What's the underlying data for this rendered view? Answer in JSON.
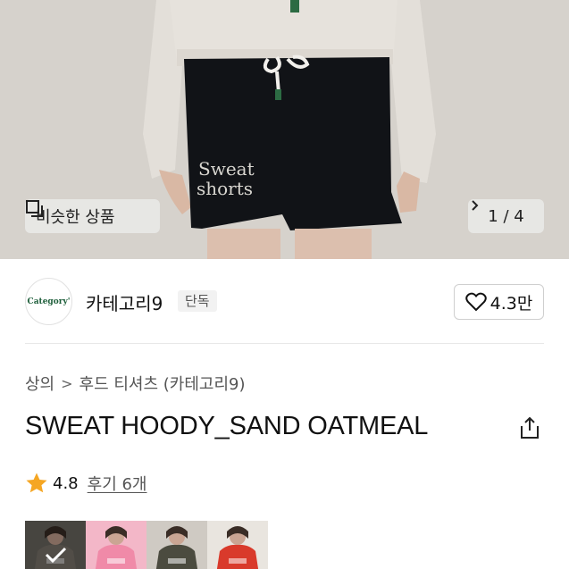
{
  "hero": {
    "print_text": "Sweat\nshorts",
    "similar_button_label": "비슷한 상품",
    "image_counter": "1 / 4"
  },
  "seller": {
    "logo_text": "Category'",
    "name": "카테고리9",
    "tag": "단독",
    "like_count": "4.3만"
  },
  "product": {
    "breadcrumb": [
      "상의",
      "후드 티셔츠 (카테고리9)"
    ],
    "title": "SWEAT HOODY_SAND OATMEAL",
    "rating": "4.8",
    "review_label": "후기 6개"
  },
  "thumbnails": [
    {
      "color": "#6e6a63",
      "hoodie": "#7d776e",
      "selected": true
    },
    {
      "color": "#f3b7c8",
      "hoodie": "#f08aa8",
      "selected": false
    },
    {
      "color": "#cfcac3",
      "hoodie": "#4b4b3f",
      "selected": false
    },
    {
      "color": "#e9e5df",
      "hoodie": "#d93a2b",
      "selected": false
    }
  ],
  "colors": {
    "star": "#f5a623",
    "logo_green": "#1d5e3a"
  }
}
